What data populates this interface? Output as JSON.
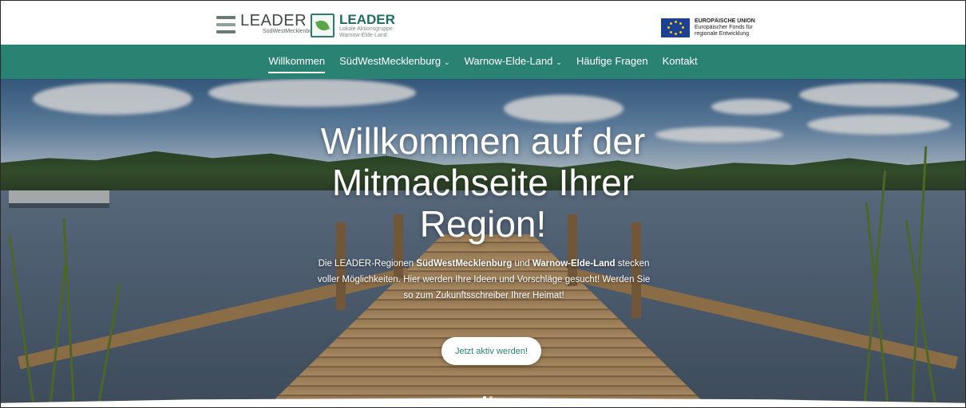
{
  "header": {
    "logo1": {
      "title": "LEADER",
      "subtitle": "SüdWestMecklenburg"
    },
    "logo2": {
      "title": "LEADER",
      "subtitle_line1": "Lokale Aktionsgruppe",
      "subtitle_line2": "Warnow-Elde-Land"
    },
    "eu": {
      "line1": "EUROPÄISCHE UNION",
      "line2": "Europäischer Fonds für",
      "line3": "regionale Entwicklung"
    }
  },
  "nav": {
    "items": [
      {
        "label": "Willkommen",
        "active": true,
        "dropdown": false
      },
      {
        "label": "SüdWestMecklenburg",
        "active": false,
        "dropdown": true
      },
      {
        "label": "Warnow-Elde-Land",
        "active": false,
        "dropdown": true
      },
      {
        "label": "Häufige Fragen",
        "active": false,
        "dropdown": false
      },
      {
        "label": "Kontakt",
        "active": false,
        "dropdown": false
      }
    ],
    "dropdown_icon": "chevron-down-icon"
  },
  "hero": {
    "title_line1": "Willkommen auf der",
    "title_line2": "Mitmachseite Ihrer",
    "title_line3": "Region!",
    "text_part1": "Die LEADER-Regionen ",
    "text_bold1": "SüdWestMecklenburg",
    "text_part2": " und ",
    "text_bold2": "Warnow-Elde-Land",
    "text_part3": " stecken voller Möglichkeiten. Hier werden Ihre Ideen und Vorschläge gesucht! Werden Sie so zum Zukunftsschreiber Ihrer Heimat!",
    "cta_label": "Jetzt aktiv werden!",
    "slides_count": 2,
    "active_slide": 1
  },
  "colors": {
    "nav_bg": "#2a8272",
    "eu_flag": "#1d3f94",
    "eu_stars": "#f5d000"
  }
}
